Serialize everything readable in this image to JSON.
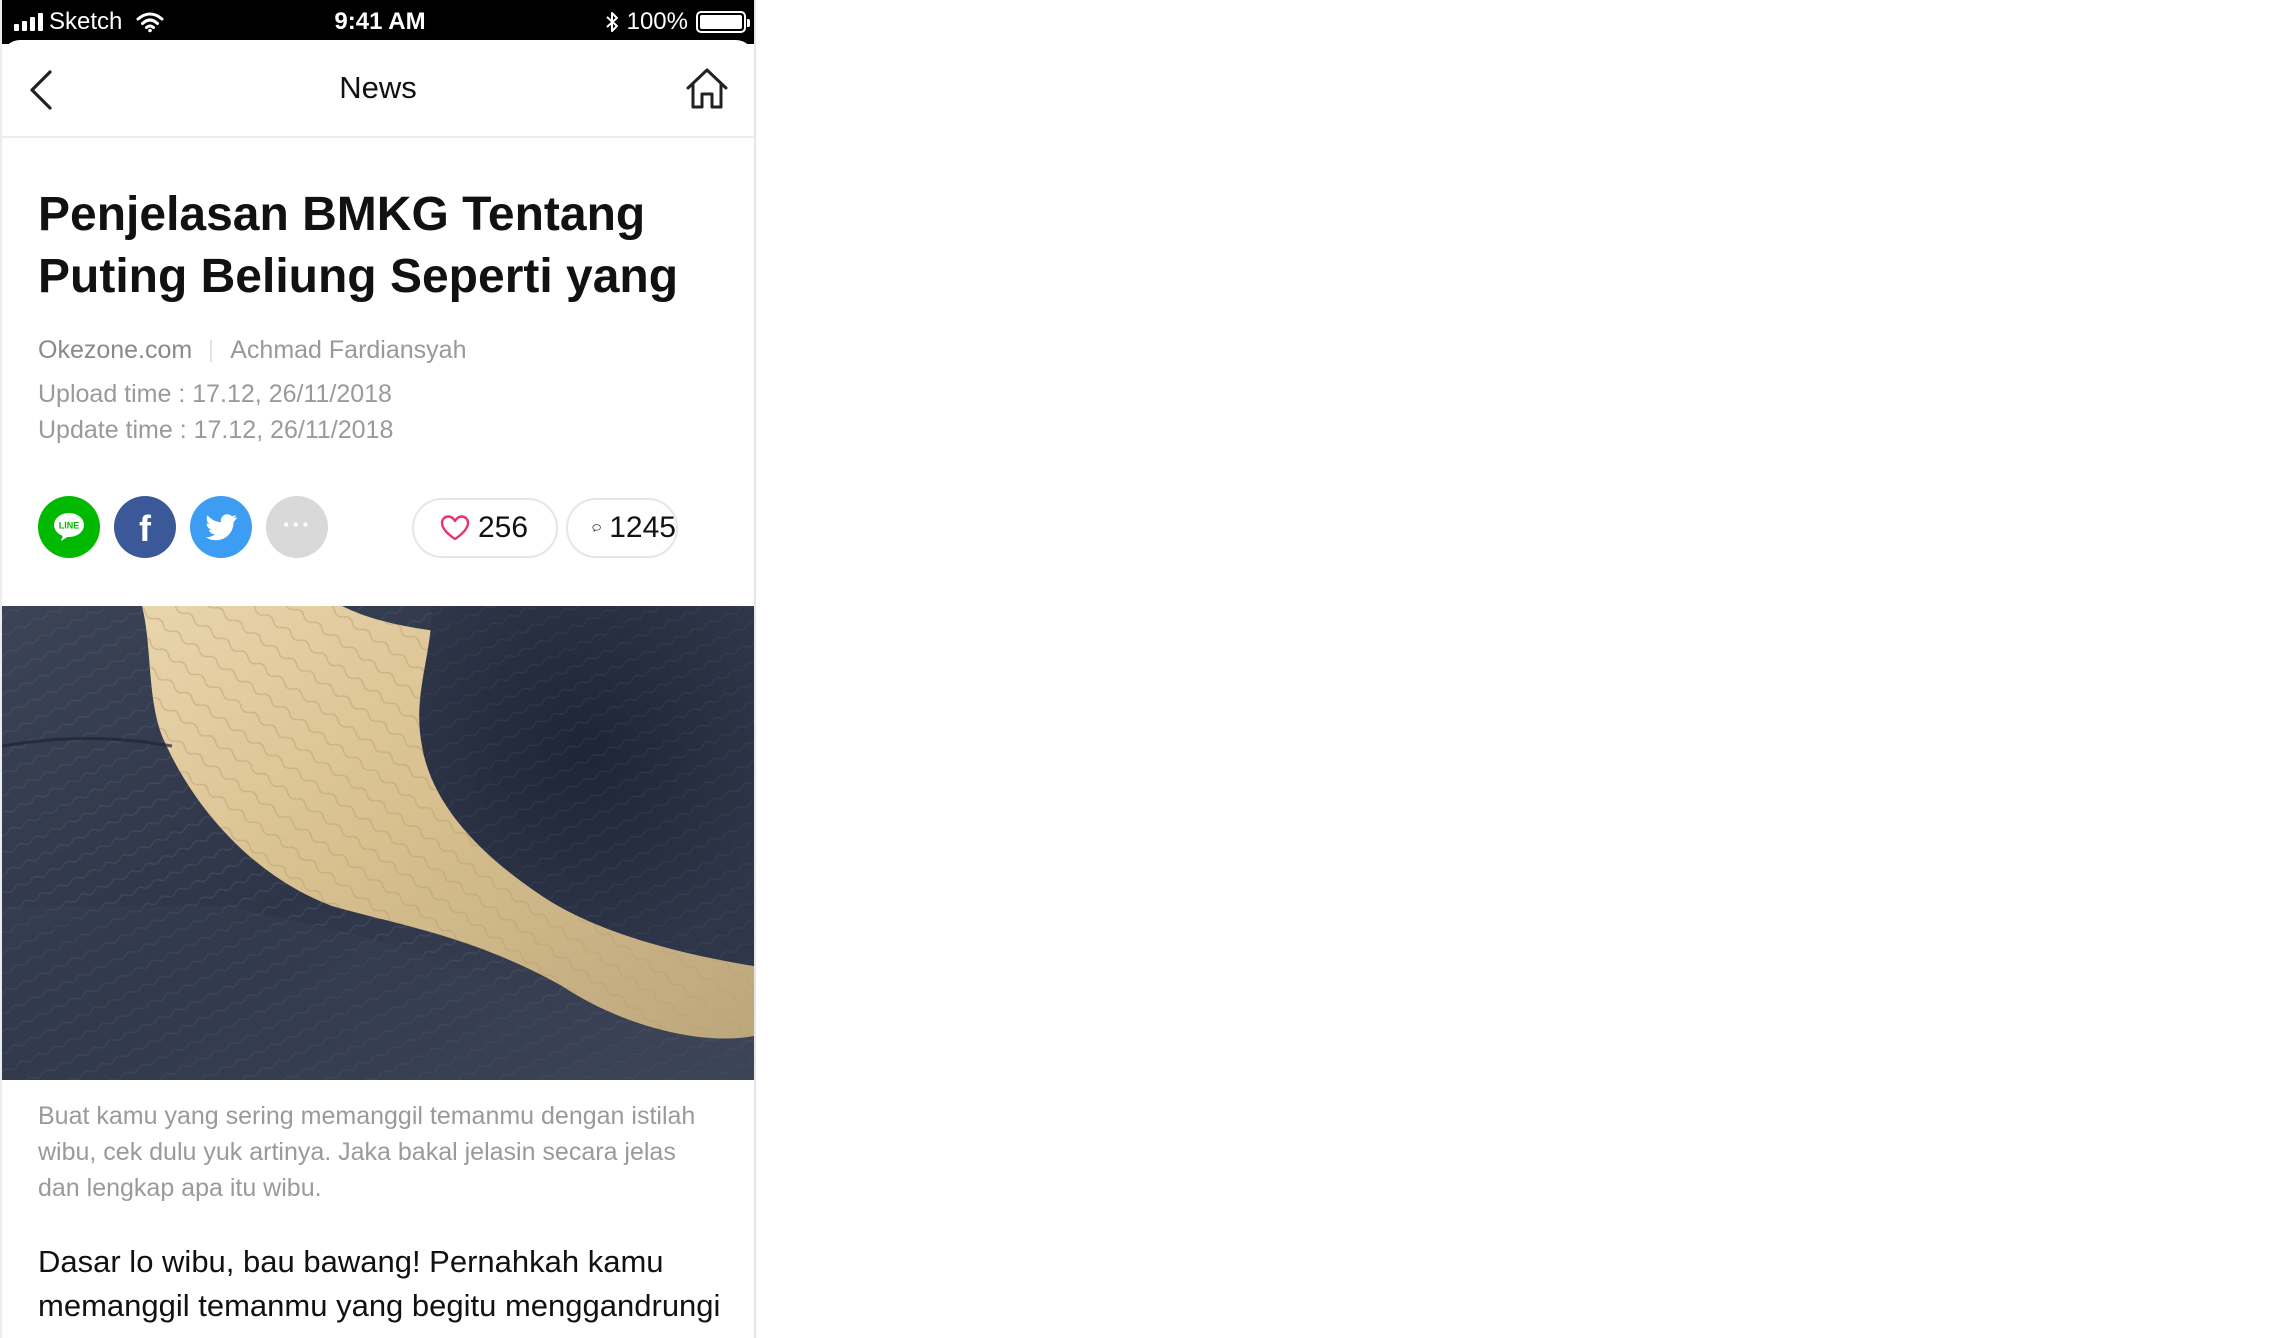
{
  "status_bar": {
    "carrier": "Sketch",
    "time": "9:41 AM",
    "battery": "100%",
    "battery_level": 1.0
  },
  "nav": {
    "title": "News",
    "back_icon": "chevron-left-icon",
    "home_icon": "home-icon"
  },
  "article": {
    "headline": "Penjelasan BMKG Tentang Puting Beliung Seperti yang",
    "source": "Okezone.com",
    "author": "Achmad Fardiansyah",
    "upload_time": "Upload time : 17.12, 26/11/2018",
    "update_time": "Update time : 17.12, 26/11/2018",
    "caption": "Buat kamu yang sering memanggil temanmu dengan istilah wibu, cek dulu yuk artinya. Jaka bakal jelasin secara jelas dan lengkap apa itu wibu.",
    "body": "Dasar lo wibu, bau bawang! Pernahkah kamu memanggil temanmu yang begitu menggandrungi anime dengan sebutan wibu?"
  },
  "share": {
    "line_label": "LINE",
    "facebook_label": "f",
    "more_label": "···",
    "line_color": "#00B900",
    "facebook_color": "#3B5998",
    "twitter_color": "#3D9DF2",
    "more_color": "#D9D9D9"
  },
  "reactions": {
    "likes": "256",
    "comments": "1245",
    "like_color": "#E8336B"
  }
}
